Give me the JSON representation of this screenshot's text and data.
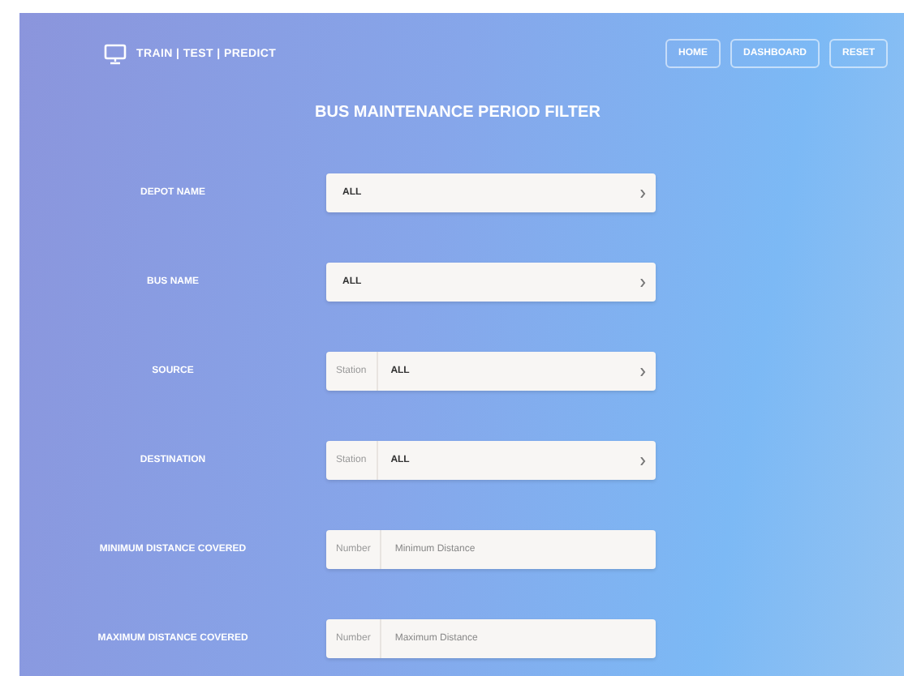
{
  "header": {
    "brand": "TRAIN | TEST | PREDICT",
    "nav": [
      "HOME",
      "DASHBOARD",
      "RESET"
    ]
  },
  "title": "BUS MAINTENANCE PERIOD FILTER",
  "fields": [
    {
      "label": "DEPOT NAME",
      "kind": "select",
      "value": "ALL"
    },
    {
      "label": "BUS NAME",
      "kind": "select",
      "value": "ALL"
    },
    {
      "label": "SOURCE",
      "kind": "select",
      "addon": "Station",
      "value": "ALL"
    },
    {
      "label": "DESTINATION",
      "kind": "select",
      "addon": "Station",
      "value": "ALL"
    },
    {
      "label": "MINIMUM DISTANCE COVERED",
      "kind": "number",
      "addon": "Number",
      "placeholder": "Minimum Distance"
    },
    {
      "label": "MAXIMUM DISTANCE COVERED",
      "kind": "number",
      "addon": "Number",
      "placeholder": "Maximum Distance"
    }
  ]
}
